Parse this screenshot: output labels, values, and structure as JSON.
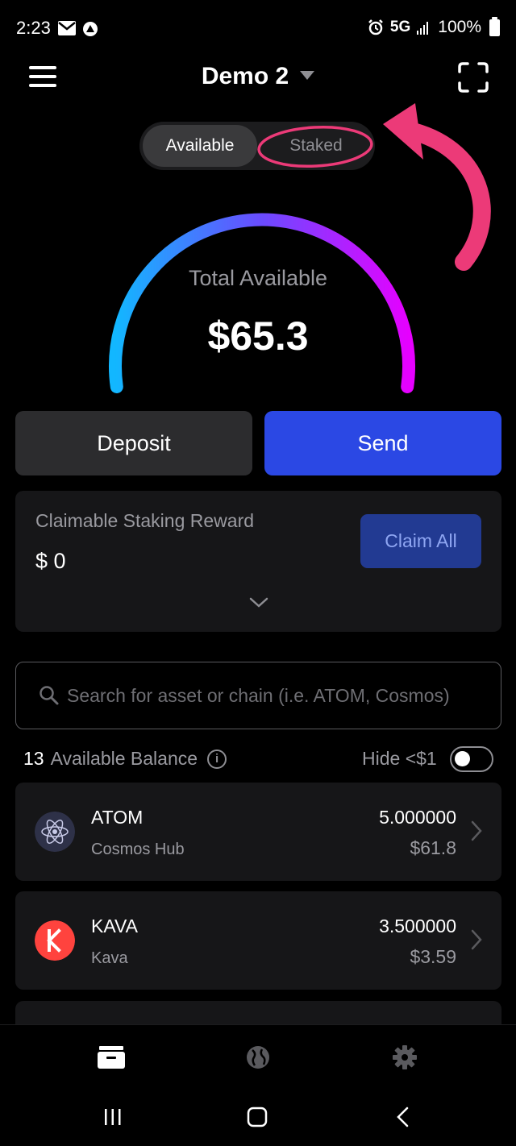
{
  "status_bar": {
    "time": "2:23",
    "network": "5G",
    "battery": "100%"
  },
  "header": {
    "title": "Demo 2"
  },
  "toggle": {
    "available_label": "Available",
    "staked_label": "Staked"
  },
  "gauge": {
    "label": "Total Available",
    "value": "$65.3"
  },
  "actions": {
    "deposit_label": "Deposit",
    "send_label": "Send"
  },
  "reward": {
    "title": "Claimable Staking Reward",
    "value": "$ 0",
    "claim_label": "Claim All"
  },
  "search": {
    "placeholder": "Search for asset or chain (i.e. ATOM, Cosmos)"
  },
  "balance": {
    "count": "13",
    "label": "Available Balance",
    "hide_label": "Hide <$1",
    "hide_small_enabled": false
  },
  "assets": [
    {
      "symbol": "ATOM",
      "chain": "Cosmos Hub",
      "amount": "5.000000",
      "value": "$61.8"
    },
    {
      "symbol": "KAVA",
      "chain": "Kava",
      "amount": "3.500000",
      "value": "$3.59"
    }
  ],
  "colors": {
    "accent": "#2b48e4",
    "gauge_start": "#12b7ff",
    "gauge_end": "#e600ff",
    "annotation": "#ec3a78",
    "kava_red": "#ff433e"
  },
  "icons": {
    "menu": "hamburger-icon",
    "scan": "scan-frame-icon",
    "search": "search-icon",
    "wallet": "wallet-icon",
    "explore": "globe-icon",
    "settings": "gear-icon"
  }
}
